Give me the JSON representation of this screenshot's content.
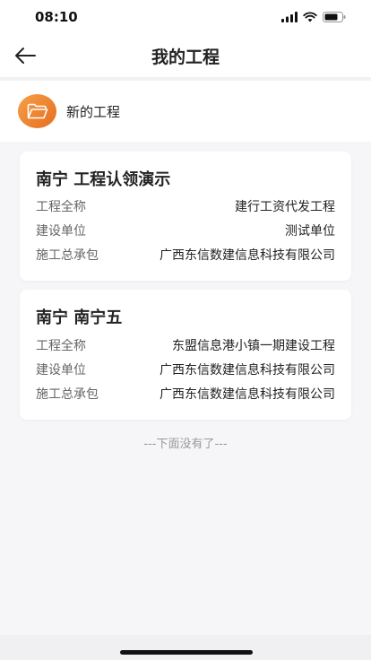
{
  "status_bar": {
    "time": "08:10",
    "icons": [
      "signal-icon",
      "wifi-icon",
      "battery-icon"
    ]
  },
  "header": {
    "title": "我的工程",
    "back_icon": "back-arrow-icon"
  },
  "new_project": {
    "label": "新的工程",
    "icon": "folder-icon"
  },
  "projects": [
    {
      "title": "南宁 工程认领演示",
      "rows": [
        {
          "label": "工程全称",
          "value": "建行工资代发工程"
        },
        {
          "label": "建设单位",
          "value": "测试单位"
        },
        {
          "label": "施工总承包",
          "value": "广西东信数建信息科技有限公司"
        }
      ]
    },
    {
      "title": "南宁 南宁五",
      "rows": [
        {
          "label": "工程全称",
          "value": "东盟信息港小镇一期建设工程"
        },
        {
          "label": "建设单位",
          "value": "广西东信数建信息科技有限公司"
        },
        {
          "label": "施工总承包",
          "value": "广西东信数建信息科技有限公司"
        }
      ]
    }
  ],
  "footer": {
    "text": "---下面没有了---"
  },
  "colors": {
    "accent": "#ef8a35",
    "background": "#f6f6f8",
    "card": "#ffffff"
  }
}
